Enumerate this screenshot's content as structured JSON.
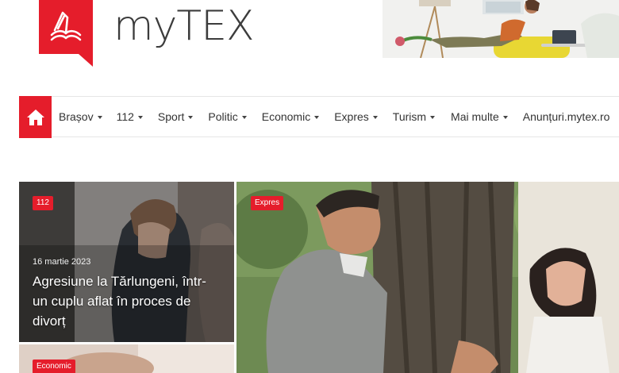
{
  "brand": {
    "name": "myTEX",
    "accent": "#e51d2b"
  },
  "nav": {
    "home_icon": "home-icon",
    "items": [
      {
        "label": "Brașov",
        "has_dropdown": true
      },
      {
        "label": "112",
        "has_dropdown": true
      },
      {
        "label": "Sport",
        "has_dropdown": true
      },
      {
        "label": "Politic",
        "has_dropdown": true
      },
      {
        "label": "Economic",
        "has_dropdown": true
      },
      {
        "label": "Expres",
        "has_dropdown": true
      },
      {
        "label": "Turism",
        "has_dropdown": true
      },
      {
        "label": "Mai multe",
        "has_dropdown": true
      },
      {
        "label": "Anunțuri.mytex.ro",
        "has_dropdown": false
      }
    ]
  },
  "articles": [
    {
      "category": "112",
      "date": "16 martie 2023",
      "title": "Agresiune la Tărlungeni, într-un cuplu aflat în proces de divorț"
    },
    {
      "category": "Expres"
    },
    {
      "category": "Economic"
    }
  ]
}
